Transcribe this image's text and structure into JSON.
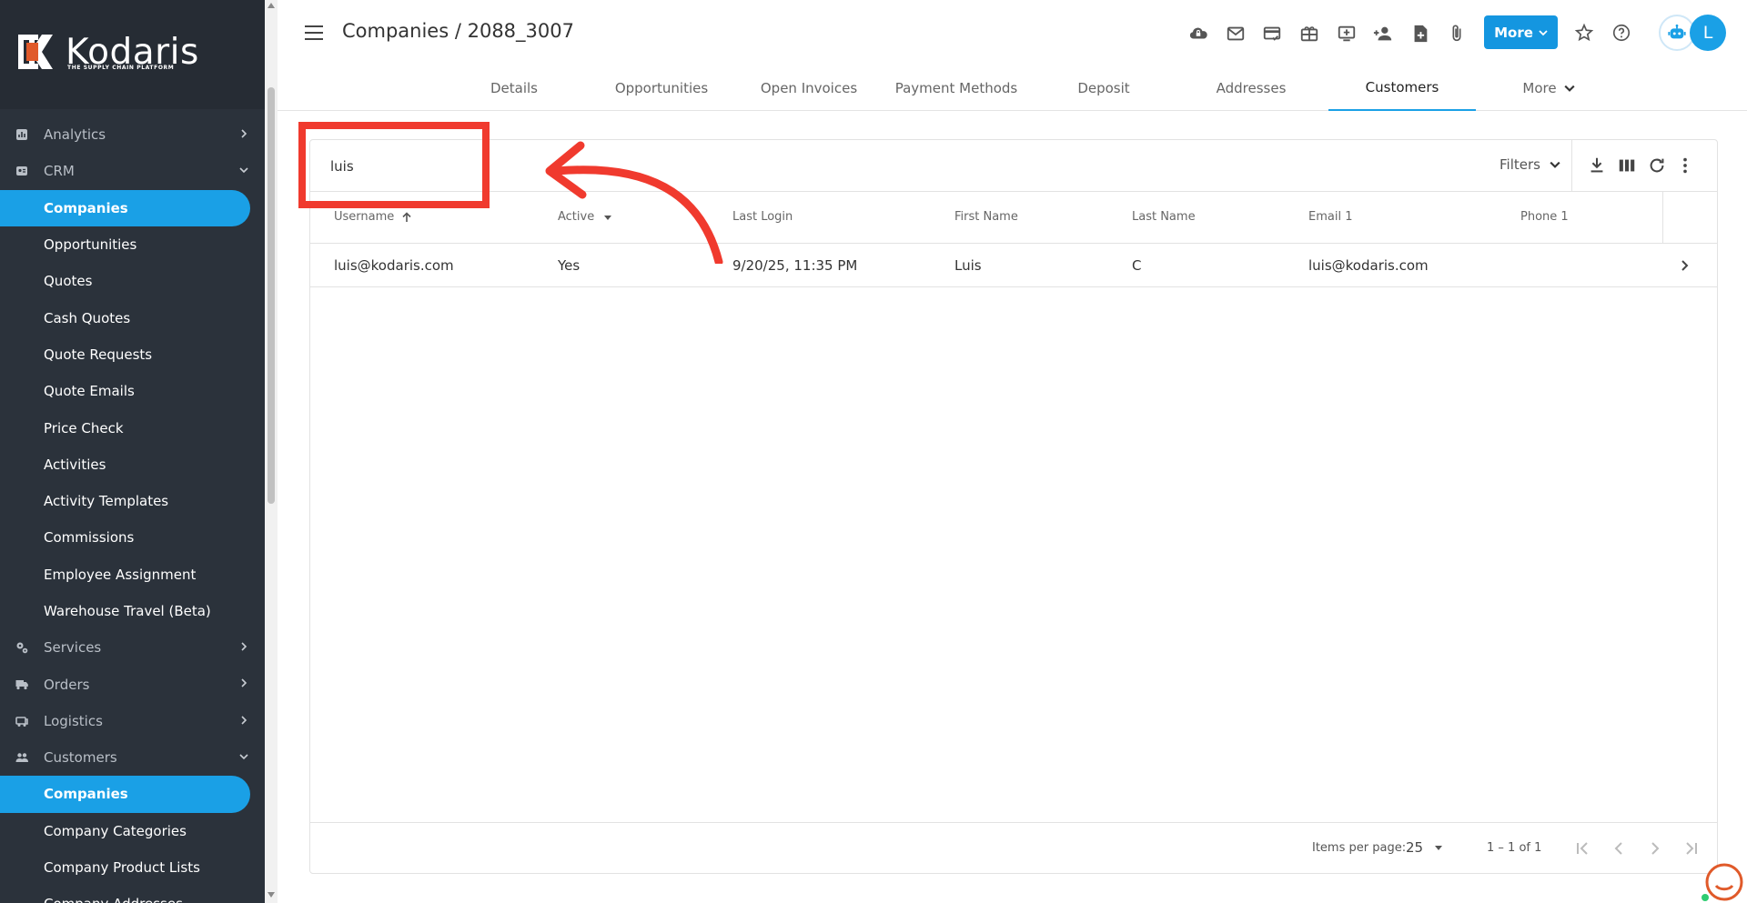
{
  "brand": {
    "name": "Kodaris",
    "tagline": "THE SUPPLY CHAIN PLATFORM",
    "accent": "#e05a2a"
  },
  "sidebar": {
    "items": [
      {
        "label": "Analytics",
        "icon": "analytics-icon",
        "type": "section",
        "chevron": "right"
      },
      {
        "label": "CRM",
        "icon": "crm-icon",
        "type": "section",
        "chevron": "down"
      },
      {
        "label": "Companies",
        "type": "sub",
        "active": true
      },
      {
        "label": "Opportunities",
        "type": "sub"
      },
      {
        "label": "Quotes",
        "type": "sub"
      },
      {
        "label": "Cash Quotes",
        "type": "sub"
      },
      {
        "label": "Quote Requests",
        "type": "sub"
      },
      {
        "label": "Quote Emails",
        "type": "sub"
      },
      {
        "label": "Price Check",
        "type": "sub"
      },
      {
        "label": "Activities",
        "type": "sub"
      },
      {
        "label": "Activity Templates",
        "type": "sub"
      },
      {
        "label": "Commissions",
        "type": "sub"
      },
      {
        "label": "Employee Assignment",
        "type": "sub"
      },
      {
        "label": "Warehouse Travel (Beta)",
        "type": "sub"
      },
      {
        "label": "Services",
        "icon": "services-icon",
        "type": "section",
        "chevron": "right"
      },
      {
        "label": "Orders",
        "icon": "orders-icon",
        "type": "section",
        "chevron": "right"
      },
      {
        "label": "Logistics",
        "icon": "logistics-icon",
        "type": "section",
        "chevron": "right"
      },
      {
        "label": "Customers",
        "icon": "customers-icon",
        "type": "section",
        "chevron": "down"
      },
      {
        "label": "Companies",
        "type": "sub",
        "active": true
      },
      {
        "label": "Company Categories",
        "type": "sub"
      },
      {
        "label": "Company Product Lists",
        "type": "sub"
      },
      {
        "label": "Company Addresses",
        "type": "sub"
      }
    ]
  },
  "header": {
    "title": "Companies / 2088_3007",
    "icons": [
      "cloud-lock-icon",
      "mail-icon",
      "card-check-icon",
      "gift-card-icon",
      "add-monitor-icon",
      "add-person-icon",
      "add-file-icon",
      "paperclip-icon"
    ],
    "more_label": "More",
    "avatar_letter": "L"
  },
  "tabs": [
    {
      "label": "Details"
    },
    {
      "label": "Opportunities"
    },
    {
      "label": "Open Invoices"
    },
    {
      "label": "Payment Methods"
    },
    {
      "label": "Deposit"
    },
    {
      "label": "Addresses"
    },
    {
      "label": "Customers",
      "active": true
    },
    {
      "label": "More"
    }
  ],
  "table": {
    "search_value": "luis",
    "filters_label": "Filters",
    "columns": [
      "Username",
      "Active",
      "Last Login",
      "First Name",
      "Last Name",
      "Email 1",
      "Phone 1"
    ],
    "rows": [
      {
        "username": "luis@kodaris.com",
        "active": "Yes",
        "last_login": "9/20/25, 11:35 PM",
        "first_name": "Luis",
        "last_name": "C",
        "email": "luis@kodaris.com",
        "phone": ""
      }
    ],
    "footer": {
      "items_per_page_label": "Items per page:",
      "items_per_page": "25",
      "range": "1 – 1 of 1"
    }
  },
  "colors": {
    "primary": "#1aa0e6",
    "annotation": "#f03a2e",
    "sidebar_bg": "#2b323b"
  }
}
